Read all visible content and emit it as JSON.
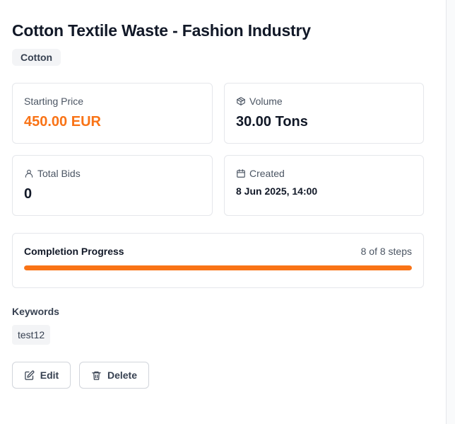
{
  "listing": {
    "title": "Cotton Textile Waste - Fashion Industry",
    "category": "Cotton"
  },
  "stats": {
    "starting_price": {
      "label": "Starting Price",
      "value": "450.00 EUR",
      "color": "#f97316"
    },
    "volume": {
      "label": "Volume",
      "value": "30.00 Tons",
      "icon": "package-icon"
    },
    "total_bids": {
      "label": "Total Bids",
      "value": "0",
      "icon": "user-icon"
    },
    "created": {
      "label": "Created",
      "value": "8 Jun 2025, 14:00",
      "icon": "calendar-icon"
    }
  },
  "progress": {
    "title": "Completion Progress",
    "steps_text": "8 of 8 steps",
    "completed_steps": 8,
    "total_steps": 8,
    "color": "#f97316"
  },
  "keywords": {
    "heading": "Keywords",
    "items": [
      "test12"
    ]
  },
  "actions": {
    "edit_label": "Edit",
    "edit_icon": "edit-icon",
    "delete_label": "Delete",
    "delete_icon": "trash-icon"
  }
}
